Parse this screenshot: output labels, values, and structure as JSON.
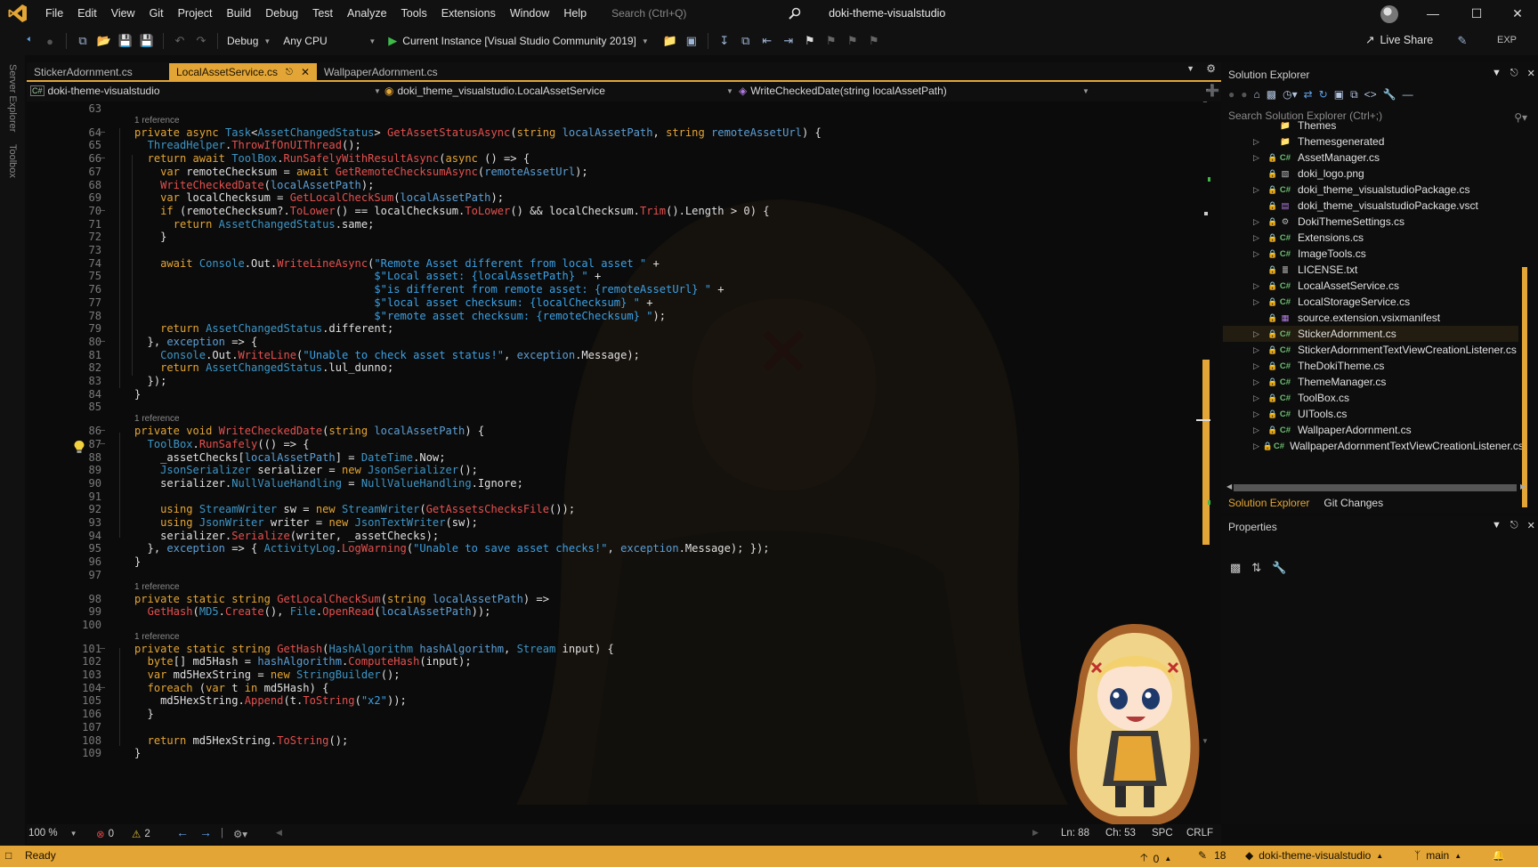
{
  "app": {
    "window_title": "doki-theme-visualstudio",
    "menu": [
      "File",
      "Edit",
      "View",
      "Git",
      "Project",
      "Build",
      "Debug",
      "Test",
      "Analyze",
      "Tools",
      "Extensions",
      "Window",
      "Help"
    ],
    "search_placeholder": "Search (Ctrl+Q)"
  },
  "toolbar": {
    "config": "Debug",
    "platform": "Any CPU",
    "run_target": "Current Instance [Visual Studio Community 2019]",
    "live_share": "Live Share",
    "exp": "EXP"
  },
  "left_strip": {
    "server_explorer": "Server Explorer",
    "toolbox": "Toolbox"
  },
  "tabs": [
    {
      "label": "StickerAdornment.cs",
      "active": false
    },
    {
      "label": "LocalAssetService.cs",
      "active": true
    },
    {
      "label": "WallpaperAdornment.cs",
      "active": false
    }
  ],
  "navbar": {
    "project": "doki-theme-visualstudio",
    "class": "doki_theme_visualstudio.LocalAssetService",
    "member": "WriteCheckedDate(string localAssetPath)"
  },
  "code": {
    "codelens": "1 reference",
    "lines": [
      {
        "n": "63",
        "t": ""
      },
      {
        "n": "64",
        "t": "private async Task<AssetChangedStatus> GetAssetStatusAsync(string localAssetPath, string remoteAssetUrl) {"
      },
      {
        "n": "65",
        "t": "  ThreadHelper.ThrowIfOnUIThread();"
      },
      {
        "n": "66",
        "t": "  return await ToolBox.RunSafelyWithResultAsync(async () => {"
      },
      {
        "n": "67",
        "t": "    var remoteChecksum = await GetRemoteChecksumAsync(remoteAssetUrl);"
      },
      {
        "n": "68",
        "t": "    WriteCheckedDate(localAssetPath);"
      },
      {
        "n": "69",
        "t": "    var localChecksum = GetLocalCheckSum(localAssetPath);"
      },
      {
        "n": "70",
        "t": "    if (remoteChecksum?.ToLower() == localChecksum.ToLower() && localChecksum.Trim().Length > 0) {"
      },
      {
        "n": "71",
        "t": "      return AssetChangedStatus.same;"
      },
      {
        "n": "72",
        "t": "    }"
      },
      {
        "n": "73",
        "t": ""
      },
      {
        "n": "74",
        "t": "    await Console.Out.WriteLineAsync(\"Remote Asset different from local asset \" +"
      },
      {
        "n": "75",
        "t": "                                     $\"Local asset: {localAssetPath} \" +"
      },
      {
        "n": "76",
        "t": "                                     $\"is different from remote asset: {remoteAssetUrl} \" +"
      },
      {
        "n": "77",
        "t": "                                     $\"local asset checksum: {localChecksum} \" +"
      },
      {
        "n": "78",
        "t": "                                     $\"remote asset checksum: {remoteChecksum} \");"
      },
      {
        "n": "79",
        "t": "    return AssetChangedStatus.different;"
      },
      {
        "n": "80",
        "t": "  }, exception => {"
      },
      {
        "n": "81",
        "t": "    Console.Out.WriteLine(\"Unable to check asset status!\", exception.Message);"
      },
      {
        "n": "82",
        "t": "    return AssetChangedStatus.lul_dunno;"
      },
      {
        "n": "83",
        "t": "  });"
      },
      {
        "n": "84",
        "t": "}"
      },
      {
        "n": "85",
        "t": ""
      },
      {
        "n": "86",
        "t": "private void WriteCheckedDate(string localAssetPath) {"
      },
      {
        "n": "87",
        "t": "  ToolBox.RunSafely(() => {"
      },
      {
        "n": "88",
        "t": "    _assetChecks[localAssetPath] = DateTime.Now;"
      },
      {
        "n": "89",
        "t": "    JsonSerializer serializer = new JsonSerializer();"
      },
      {
        "n": "90",
        "t": "    serializer.NullValueHandling = NullValueHandling.Ignore;"
      },
      {
        "n": "91",
        "t": ""
      },
      {
        "n": "92",
        "t": "    using StreamWriter sw = new StreamWriter(GetAssetsChecksFile());"
      },
      {
        "n": "93",
        "t": "    using JsonWriter writer = new JsonTextWriter(sw);"
      },
      {
        "n": "94",
        "t": "    serializer.Serialize(writer, _assetChecks);"
      },
      {
        "n": "95",
        "t": "  }, exception => { ActivityLog.LogWarning(\"Unable to save asset checks!\", exception.Message); });"
      },
      {
        "n": "96",
        "t": "}"
      },
      {
        "n": "97",
        "t": ""
      },
      {
        "n": "98",
        "t": "private static string GetLocalCheckSum(string localAssetPath) =>"
      },
      {
        "n": "99",
        "t": "  GetHash(MD5.Create(), File.OpenRead(localAssetPath));"
      },
      {
        "n": "100",
        "t": ""
      },
      {
        "n": "101",
        "t": "private static string GetHash(HashAlgorithm hashAlgorithm, Stream input) {"
      },
      {
        "n": "102",
        "t": "  byte[] md5Hash = hashAlgorithm.ComputeHash(input);"
      },
      {
        "n": "103",
        "t": "  var md5HexString = new StringBuilder();"
      },
      {
        "n": "104",
        "t": "  foreach (var t in md5Hash) {"
      },
      {
        "n": "105",
        "t": "    md5HexString.Append(t.ToString(\"x2\"));"
      },
      {
        "n": "106",
        "t": "  }"
      },
      {
        "n": "107",
        "t": ""
      },
      {
        "n": "108",
        "t": "  return md5HexString.ToString();"
      },
      {
        "n": "109",
        "t": "}"
      }
    ]
  },
  "editor_status": {
    "zoom": "100 %",
    "errors": "0",
    "warnings": "2",
    "ln": "Ln: 88",
    "ch": "Ch: 53",
    "spc": "SPC",
    "crlf": "CRLF"
  },
  "solution_explorer": {
    "title": "Solution Explorer",
    "search_placeholder": "Search Solution Explorer (Ctrl+;)",
    "items": [
      {
        "name": "Themes",
        "kind": "folder",
        "expandable": false,
        "selected": false
      },
      {
        "name": "Themesgenerated",
        "kind": "folder",
        "expandable": true,
        "selected": false
      },
      {
        "name": "AssetManager.cs",
        "kind": "cs",
        "expandable": true,
        "selected": false
      },
      {
        "name": "doki_logo.png",
        "kind": "image",
        "expandable": false,
        "selected": false
      },
      {
        "name": "doki_theme_visualstudioPackage.cs",
        "kind": "cs",
        "expandable": true,
        "selected": false
      },
      {
        "name": "doki_theme_visualstudioPackage.vsct",
        "kind": "vsct",
        "expandable": false,
        "selected": false
      },
      {
        "name": "DokiThemeSettings.cs",
        "kind": "settings",
        "expandable": true,
        "selected": false
      },
      {
        "name": "Extensions.cs",
        "kind": "cs",
        "expandable": true,
        "selected": false
      },
      {
        "name": "ImageTools.cs",
        "kind": "cs",
        "expandable": true,
        "selected": false
      },
      {
        "name": "LICENSE.txt",
        "kind": "text",
        "expandable": false,
        "selected": false
      },
      {
        "name": "LocalAssetService.cs",
        "kind": "cs",
        "expandable": true,
        "selected": false
      },
      {
        "name": "LocalStorageService.cs",
        "kind": "cs",
        "expandable": true,
        "selected": false
      },
      {
        "name": "source.extension.vsixmanifest",
        "kind": "manifest",
        "expandable": false,
        "selected": false
      },
      {
        "name": "StickerAdornment.cs",
        "kind": "cs",
        "expandable": true,
        "selected": true
      },
      {
        "name": "StickerAdornmentTextViewCreationListener.cs",
        "kind": "cs",
        "expandable": true,
        "selected": false
      },
      {
        "name": "TheDokiTheme.cs",
        "kind": "cs",
        "expandable": true,
        "selected": false
      },
      {
        "name": "ThemeManager.cs",
        "kind": "cs",
        "expandable": true,
        "selected": false
      },
      {
        "name": "ToolBox.cs",
        "kind": "cs",
        "expandable": true,
        "selected": false
      },
      {
        "name": "UITools.cs",
        "kind": "cs",
        "expandable": true,
        "selected": false
      },
      {
        "name": "WallpaperAdornment.cs",
        "kind": "cs",
        "expandable": true,
        "selected": false
      },
      {
        "name": "WallpaperAdornmentTextViewCreationListener.cs",
        "kind": "cs",
        "expandable": true,
        "selected": false
      }
    ],
    "tabs": [
      "Solution Explorer",
      "Git Changes"
    ]
  },
  "properties": {
    "title": "Properties"
  },
  "status_bar": {
    "state": "Ready",
    "push_count": "0",
    "pending_changes": "18",
    "repo": "doki-theme-visualstudio",
    "branch": "main"
  },
  "colors": {
    "accent": "#e3a535",
    "keyword": "#e5a534",
    "type": "#3d96c7",
    "method": "#e5504f",
    "string": "#3aa1e6"
  }
}
